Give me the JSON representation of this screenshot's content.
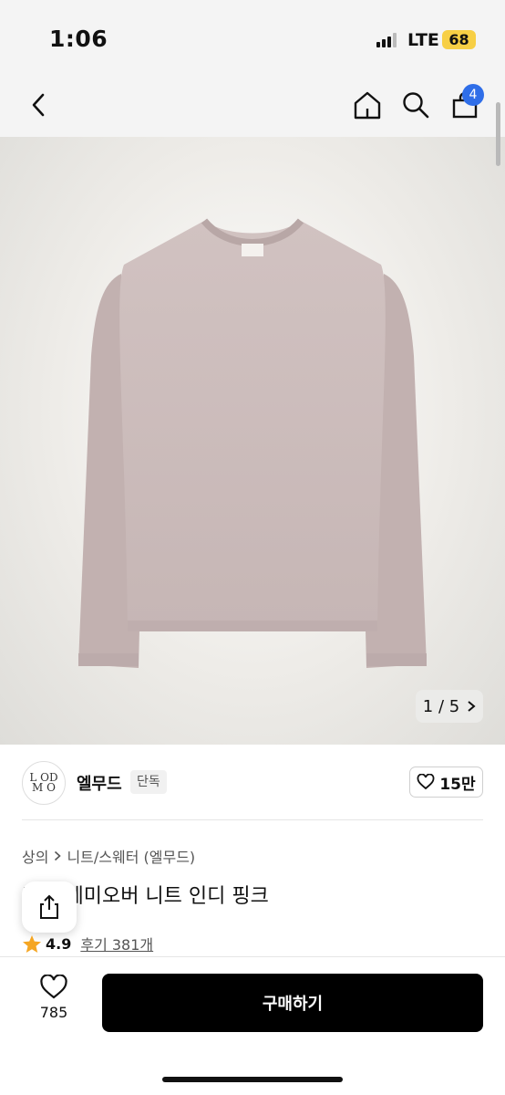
{
  "status_bar": {
    "time": "1:06",
    "network": "LTE",
    "battery": "68"
  },
  "nav": {
    "cart_count": "4",
    "icons": [
      "back-icon",
      "home-icon",
      "search-icon",
      "cart-icon"
    ]
  },
  "gallery": {
    "current": "1",
    "separator": "/",
    "total": "5"
  },
  "brand": {
    "logo_text_top": "L OD",
    "logo_text_bottom": "M O",
    "name": "엘무드",
    "badge": "단독"
  },
  "like": {
    "count": "15만"
  },
  "breadcrumb": {
    "category": "상의",
    "separator": ">",
    "subcategory": "니트/스웨터 (엘무드)"
  },
  "product": {
    "title": "홀가 세미오버 니트 인디 핑크"
  },
  "rating": {
    "score": "4.9",
    "reviews": "후기 381개"
  },
  "bottom": {
    "wish_count": "785",
    "buy_label": "구매하기"
  },
  "colors": {
    "sweater": "#cdbdbc",
    "cart_badge": "#2f6ee8",
    "battery": "#f7cf45",
    "star": "#f5a623"
  }
}
